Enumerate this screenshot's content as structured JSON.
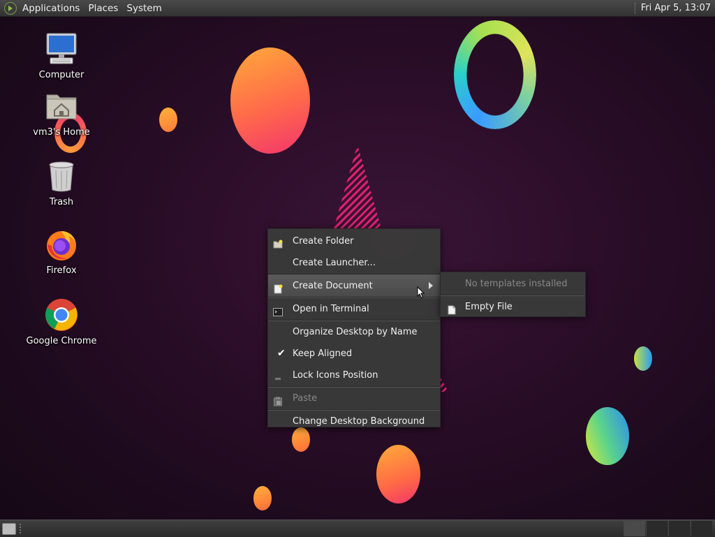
{
  "top_panel": {
    "menus": [
      "Applications",
      "Places",
      "System"
    ],
    "clock": "Fri Apr  5, 13:07"
  },
  "desktop_icons": [
    {
      "label": "Computer",
      "icon": "computer-icon"
    },
    {
      "label": "vm3's Home",
      "icon": "home-folder-icon"
    },
    {
      "label": "Trash",
      "icon": "trash-icon"
    },
    {
      "label": "Firefox",
      "icon": "firefox-icon"
    },
    {
      "label": "Google Chrome",
      "icon": "chrome-icon"
    }
  ],
  "context_menu": {
    "items": [
      {
        "label": "Create Folder",
        "icon": "folder-new-icon"
      },
      {
        "label": "Create Launcher...",
        "icon": ""
      },
      {
        "label": "Create Document",
        "icon": "document-new-icon",
        "submenu": true
      },
      {
        "label": "Open in Terminal",
        "icon": "terminal-icon"
      },
      {
        "label": "Organize Desktop by Name",
        "icon": ""
      },
      {
        "label": "Keep Aligned",
        "icon": "check-icon",
        "checked": true
      },
      {
        "label": "Lock Icons Position",
        "icon": "lock-icon"
      },
      {
        "label": "Paste",
        "icon": "paste-icon",
        "disabled": true
      },
      {
        "label": "Change Desktop Background",
        "icon": ""
      }
    ]
  },
  "submenu": {
    "items": [
      {
        "label": "No templates installed",
        "disabled": true
      },
      {
        "label": "Empty File",
        "icon": "file-icon"
      }
    ]
  },
  "colors": {
    "panel": "#3a3a3a",
    "menu_bg": "#3a3a3a",
    "desktop_bg": "#2a0d28",
    "accent_pink": "#e0206f"
  }
}
